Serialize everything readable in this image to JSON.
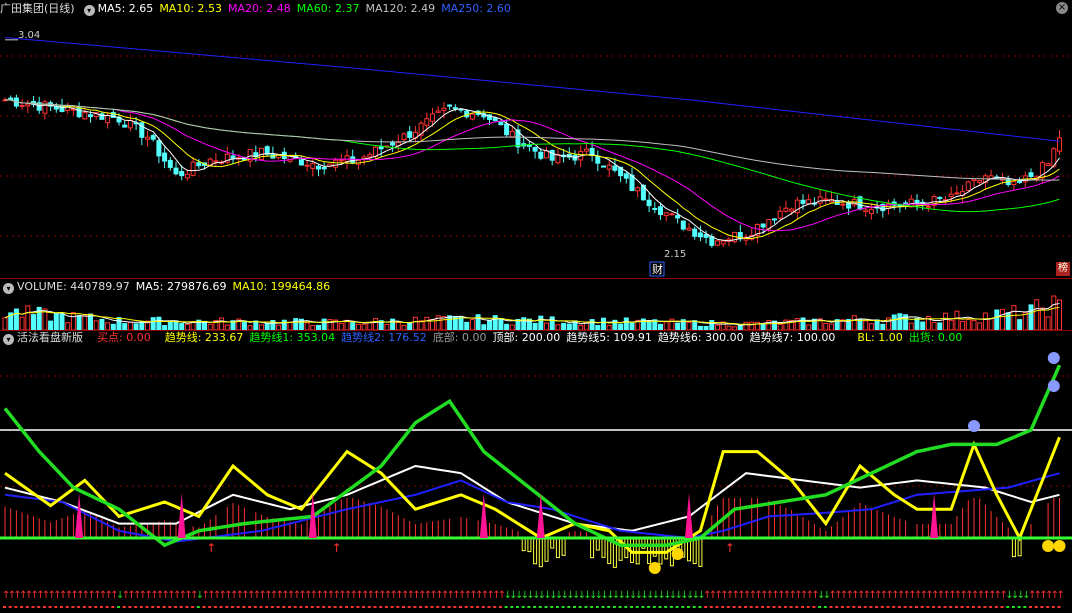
{
  "main_header": {
    "title": "广田集团(日线)",
    "ma5": "MA5: 2.65",
    "ma10": "MA10: 2.53",
    "ma20": "MA20: 2.48",
    "ma60": "MA60: 2.37",
    "ma120": "MA120: 2.49",
    "ma250": "MA250: 2.60"
  },
  "volume_header": {
    "volume": "VOLUME: 440789.97",
    "ma5": "MA5: 279876.69",
    "ma10": "MA10: 199464.86"
  },
  "indicator_header": {
    "name": "活法看盘新版",
    "buy": "买点: 0.00",
    "trend": "趋势线: 233.67",
    "trend1": "趋势线1: 353.04",
    "trend2": "趋势线2: 176.52",
    "bottom": "底部: 0.00",
    "top": "顶部: 200.00",
    "trend5": "趋势线5: 109.91",
    "trend6": "趋势线6: 300.00",
    "trend7": "趋势线7: 100.00",
    "bl": "BL: 1.00",
    "sell": "出货: 0.00"
  },
  "annotations": {
    "high_price": "3.04",
    "low_price": "2.15",
    "fin_marker": "财",
    "side_badge": "榜"
  },
  "colors": {
    "up": "#ff3232",
    "down": "#54ffff",
    "ma5": "#ffffff",
    "ma10": "#ffff00",
    "ma20": "#ff00ff",
    "ma60": "#00ff00",
    "ma120": "#c0c0c0",
    "ma250": "#2020ff"
  },
  "chart_data": [
    {
      "type": "candlestick",
      "title": "广田集团(日线)",
      "series_names": [
        "MA5",
        "MA10",
        "MA20",
        "MA60",
        "MA120",
        "MA250"
      ],
      "y_range": [
        2.05,
        3.1
      ],
      "close_anchors": [
        [
          0,
          2.78
        ],
        [
          10,
          2.74
        ],
        [
          20,
          2.7
        ],
        [
          25,
          2.62
        ],
        [
          30,
          2.45
        ],
        [
          36,
          2.52
        ],
        [
          45,
          2.55
        ],
        [
          55,
          2.5
        ],
        [
          62,
          2.52
        ],
        [
          70,
          2.62
        ],
        [
          78,
          2.74
        ],
        [
          84,
          2.72
        ],
        [
          90,
          2.6
        ],
        [
          96,
          2.52
        ],
        [
          103,
          2.55
        ],
        [
          110,
          2.4
        ],
        [
          118,
          2.25
        ],
        [
          124,
          2.17
        ],
        [
          130,
          2.2
        ],
        [
          138,
          2.33
        ],
        [
          145,
          2.34
        ],
        [
          152,
          2.32
        ],
        [
          160,
          2.33
        ],
        [
          166,
          2.35
        ],
        [
          172,
          2.45
        ],
        [
          177,
          2.4
        ],
        [
          183,
          2.5
        ],
        [
          185,
          2.62
        ]
      ],
      "annotations": [
        {
          "label": "3.04",
          "type": "high"
        },
        {
          "label": "2.15",
          "type": "low"
        }
      ]
    },
    {
      "type": "bar",
      "title": "VOLUME",
      "series_names": [
        "VOLUME",
        "MA5",
        "MA10"
      ],
      "values_last": [
        440789.97,
        279876.69,
        199464.86
      ]
    },
    {
      "type": "line",
      "title": "活法看盘新版",
      "series": [
        {
          "name": "趋势线",
          "last": 233.67
        },
        {
          "name": "趋势线1",
          "last": 353.04
        },
        {
          "name": "趋势线2",
          "last": 176.52
        },
        {
          "name": "底部",
          "last": 0.0
        },
        {
          "name": "顶部",
          "last": 200.0
        },
        {
          "name": "趋势线5",
          "last": 109.91
        },
        {
          "name": "趋势线6",
          "last": 300.0
        },
        {
          "name": "趋势线7",
          "last": 100.0
        },
        {
          "name": "BL",
          "last": 1.0
        },
        {
          "name": "出货",
          "last": 0.0
        }
      ],
      "yellow_anchors": [
        [
          0,
          90
        ],
        [
          8,
          45
        ],
        [
          14,
          80
        ],
        [
          20,
          30
        ],
        [
          28,
          50
        ],
        [
          34,
          30
        ],
        [
          40,
          100
        ],
        [
          46,
          60
        ],
        [
          52,
          40
        ],
        [
          60,
          120
        ],
        [
          66,
          90
        ],
        [
          72,
          40
        ],
        [
          80,
          60
        ],
        [
          86,
          40
        ],
        [
          94,
          0
        ],
        [
          100,
          20
        ],
        [
          106,
          10
        ],
        [
          110,
          -20
        ],
        [
          116,
          -20
        ],
        [
          122,
          10
        ],
        [
          126,
          120
        ],
        [
          132,
          120
        ],
        [
          138,
          80
        ],
        [
          144,
          20
        ],
        [
          150,
          100
        ],
        [
          156,
          60
        ],
        [
          160,
          40
        ],
        [
          166,
          40
        ],
        [
          170,
          130
        ],
        [
          174,
          60
        ],
        [
          178,
          0
        ],
        [
          183,
          100
        ],
        [
          185,
          140
        ]
      ],
      "green_anchors": [
        [
          0,
          180
        ],
        [
          6,
          120
        ],
        [
          12,
          70
        ],
        [
          20,
          40
        ],
        [
          28,
          -10
        ],
        [
          34,
          10
        ],
        [
          42,
          20
        ],
        [
          54,
          30
        ],
        [
          66,
          100
        ],
        [
          72,
          160
        ],
        [
          78,
          190
        ],
        [
          84,
          120
        ],
        [
          92,
          70
        ],
        [
          100,
          20
        ],
        [
          108,
          -10
        ],
        [
          116,
          -10
        ],
        [
          122,
          0
        ],
        [
          128,
          40
        ],
        [
          136,
          50
        ],
        [
          144,
          60
        ],
        [
          152,
          90
        ],
        [
          160,
          120
        ],
        [
          166,
          130
        ],
        [
          174,
          130
        ],
        [
          180,
          150
        ],
        [
          185,
          240
        ]
      ],
      "white_anchors": [
        [
          0,
          70
        ],
        [
          10,
          50
        ],
        [
          20,
          20
        ],
        [
          30,
          20
        ],
        [
          40,
          60
        ],
        [
          50,
          40
        ],
        [
          60,
          60
        ],
        [
          72,
          100
        ],
        [
          80,
          90
        ],
        [
          88,
          50
        ],
        [
          100,
          20
        ],
        [
          110,
          10
        ],
        [
          120,
          30
        ],
        [
          130,
          90
        ],
        [
          140,
          80
        ],
        [
          150,
          70
        ],
        [
          160,
          80
        ],
        [
          172,
          70
        ],
        [
          180,
          50
        ],
        [
          185,
          60
        ]
      ],
      "blue_anchors": [
        [
          0,
          60
        ],
        [
          10,
          50
        ],
        [
          20,
          10
        ],
        [
          30,
          -5
        ],
        [
          45,
          10
        ],
        [
          60,
          40
        ],
        [
          72,
          60
        ],
        [
          80,
          80
        ],
        [
          88,
          50
        ],
        [
          96,
          40
        ],
        [
          108,
          10
        ],
        [
          120,
          0
        ],
        [
          126,
          10
        ],
        [
          134,
          30
        ],
        [
          144,
          35
        ],
        [
          152,
          40
        ],
        [
          160,
          60
        ],
        [
          168,
          65
        ],
        [
          176,
          70
        ],
        [
          185,
          90
        ]
      ]
    }
  ]
}
